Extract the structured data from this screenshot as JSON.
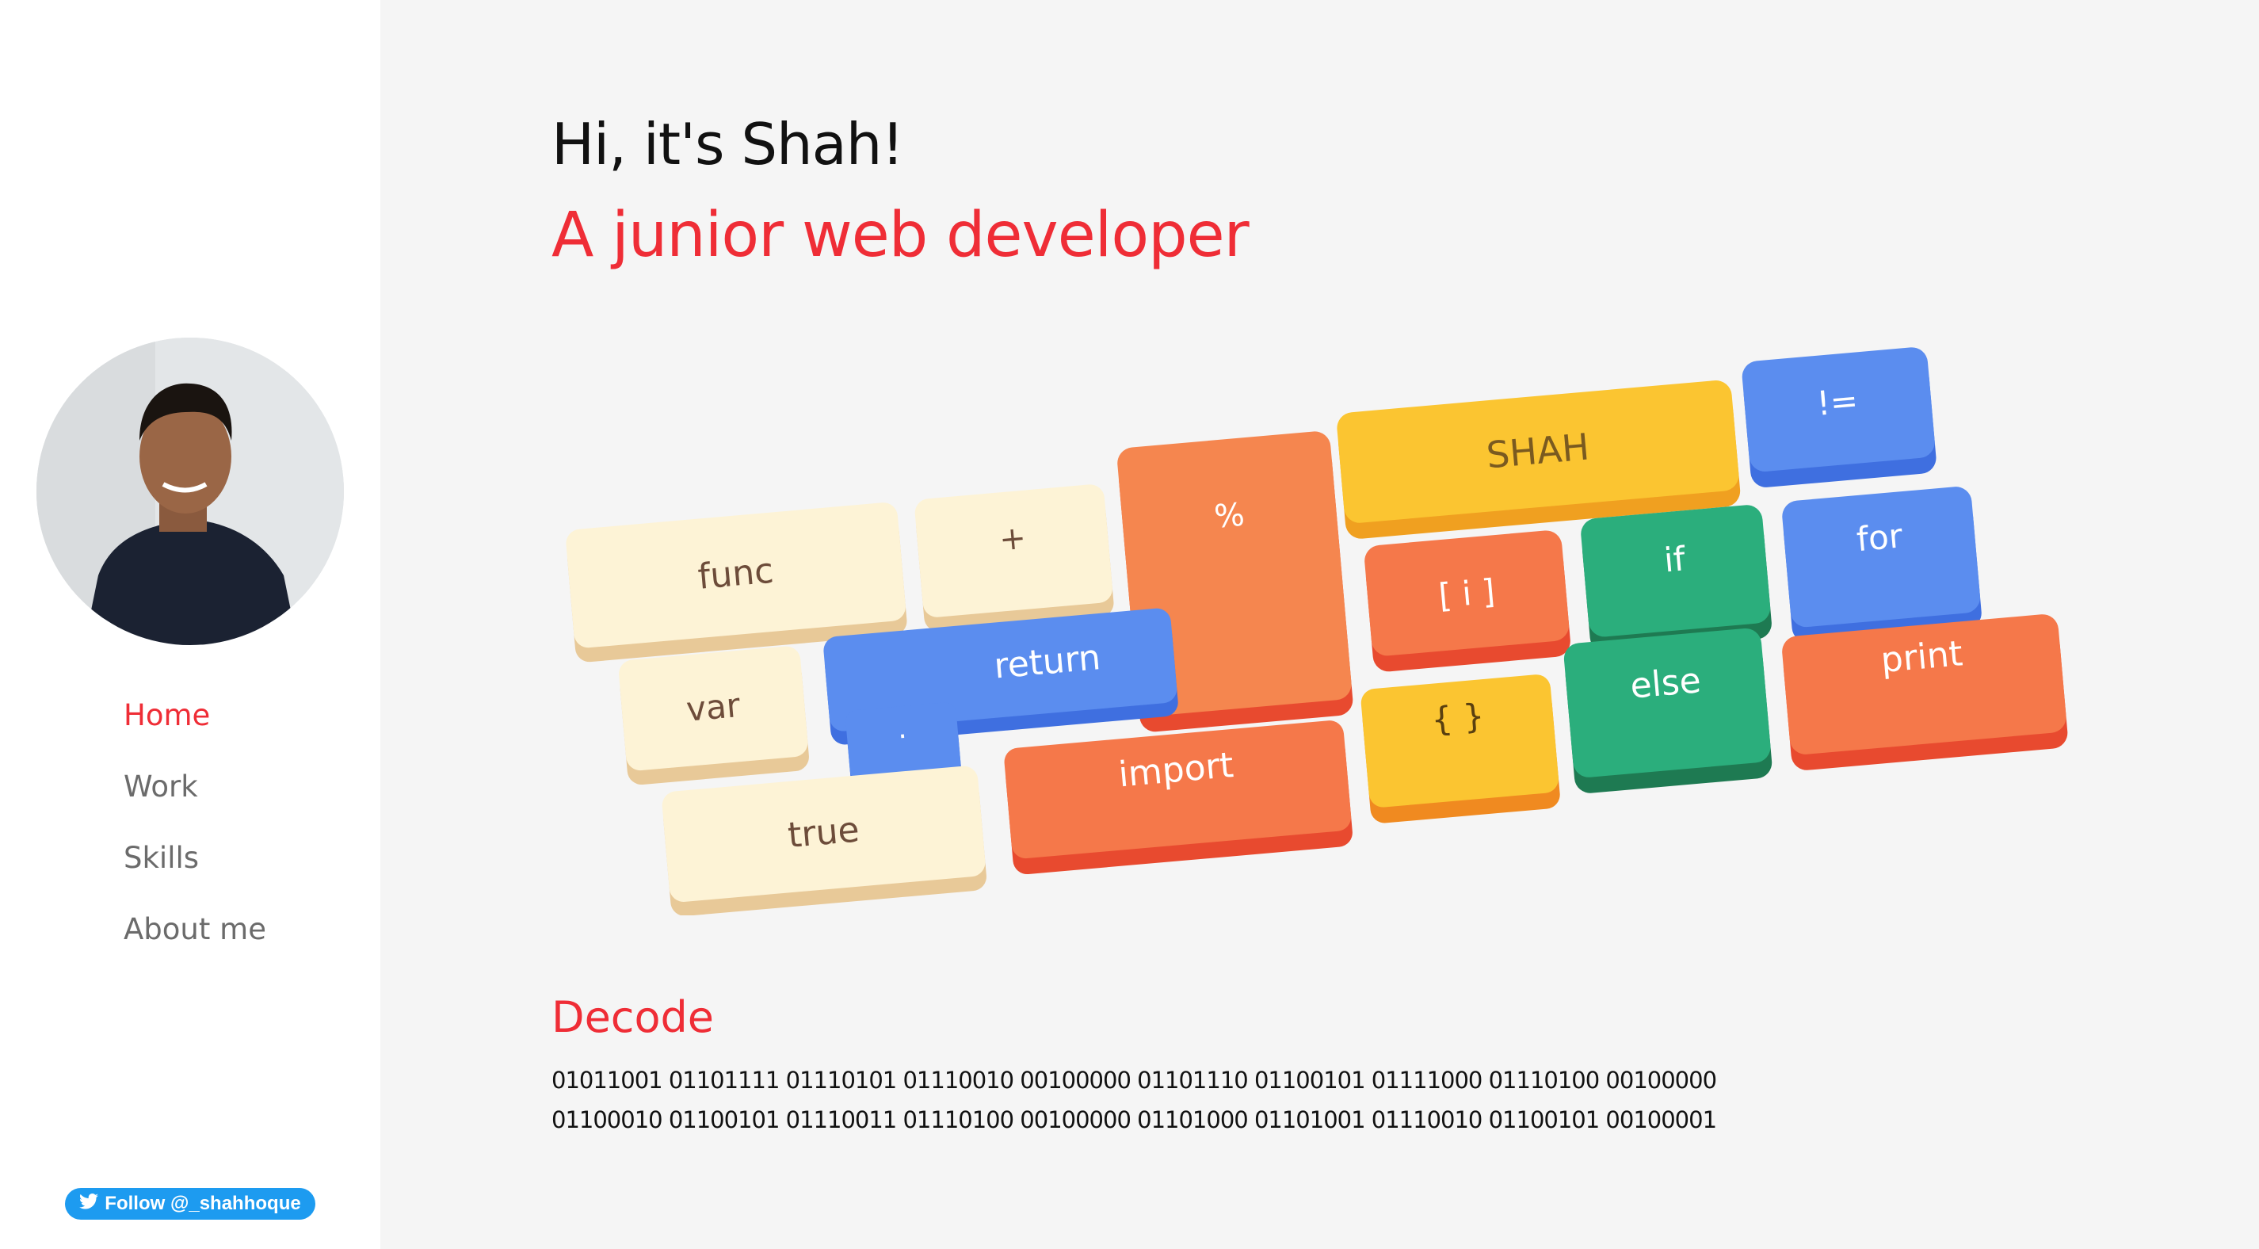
{
  "sidebar": {
    "nav": [
      {
        "label": "Home",
        "active": true
      },
      {
        "label": "Work",
        "active": false
      },
      {
        "label": "Skills",
        "active": false
      },
      {
        "label": "About me",
        "active": false
      }
    ],
    "twitter_button": "Follow @_shahhoque"
  },
  "main": {
    "greeting": "Hi, it's Shah!",
    "tagline": "A junior web developer",
    "keyboard_keys": {
      "func": "func",
      "plus": "+",
      "percent": "%",
      "shah": "SHAH",
      "neq": "!=",
      "var": "var",
      "return": "return",
      "dot": ".",
      "index": "[ i ]",
      "if": "if",
      "for": "for",
      "true": "true",
      "import": "import",
      "braces": "{ }",
      "else": "else",
      "print": "print"
    },
    "decode": {
      "heading": "Decode",
      "line1": "01011001 01101111 01110101 01110010 00100000 01101110 01100101 01111000 01110100 00100000",
      "line2": "01100010 01100101 01110011 01110100 00100000 01101000 01101001 01110010 01100101 00100001"
    }
  },
  "colors": {
    "accent": "#ef2d36",
    "twitter": "#1d9bf0",
    "cream_key": "#fdf3d6",
    "blue_key": "#5b8def",
    "orange_key": "#f5784a",
    "yellow_key": "#fbc531",
    "green_key": "#2bae7c"
  }
}
